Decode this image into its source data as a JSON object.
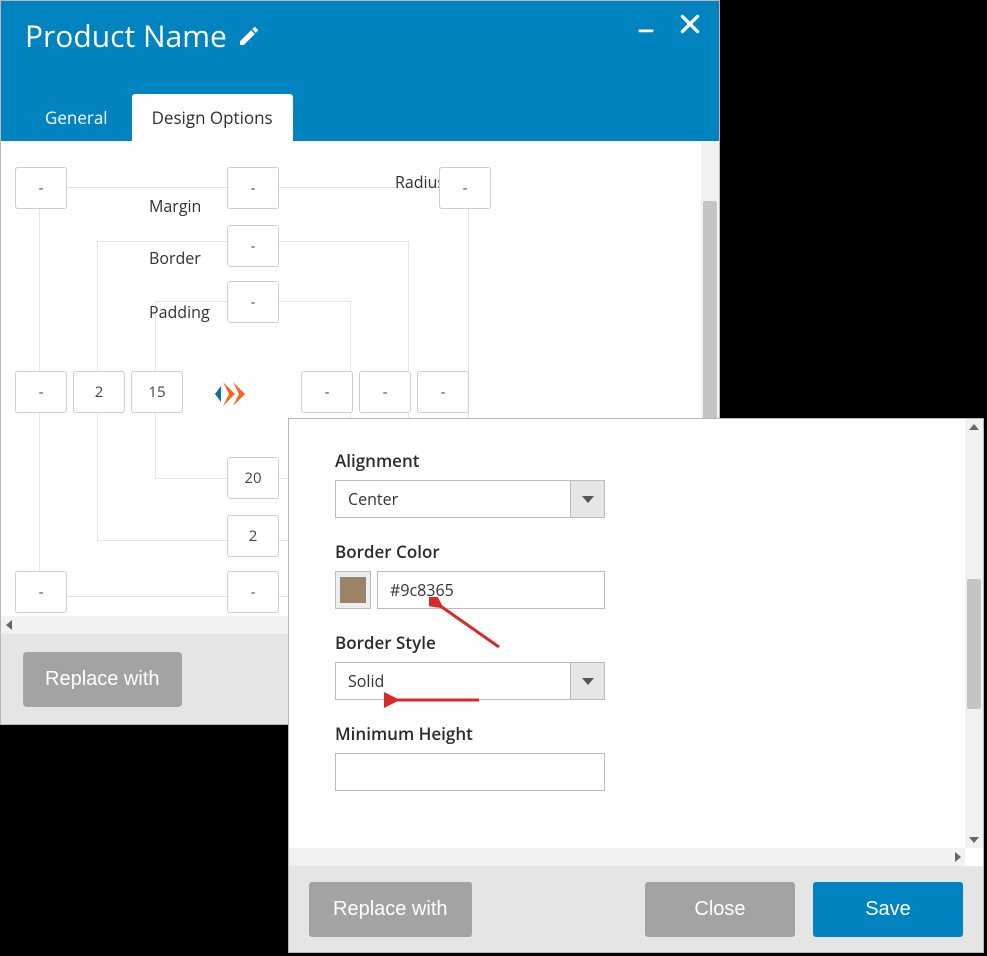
{
  "back": {
    "title": "Product Name",
    "tabs": {
      "general": "General",
      "design": "Design Options"
    },
    "footer": {
      "replace": "Replace with"
    },
    "boxModel": {
      "marginLabel": "Margin",
      "borderLabel": "Border",
      "paddingLabel": "Padding",
      "radiusLabel": "Radius",
      "margin": {
        "top": "-",
        "right": "-",
        "bottom": "-",
        "left": "-"
      },
      "border": {
        "top": "-",
        "right": "-",
        "bottom": "2",
        "left": "2"
      },
      "padding": {
        "top": "-",
        "right": "-",
        "bottom": "20",
        "left": "15"
      },
      "radius": {
        "topRight": "-"
      }
    }
  },
  "front": {
    "fields": {
      "alignment": {
        "label": "Alignment",
        "value": "Center"
      },
      "borderColor": {
        "label": "Border Color",
        "value": "#9c8365"
      },
      "borderStyle": {
        "label": "Border Style",
        "value": "Solid"
      },
      "minHeight": {
        "label": "Minimum Height",
        "value": ""
      }
    },
    "footer": {
      "replace": "Replace with",
      "close": "Close",
      "save": "Save"
    }
  }
}
